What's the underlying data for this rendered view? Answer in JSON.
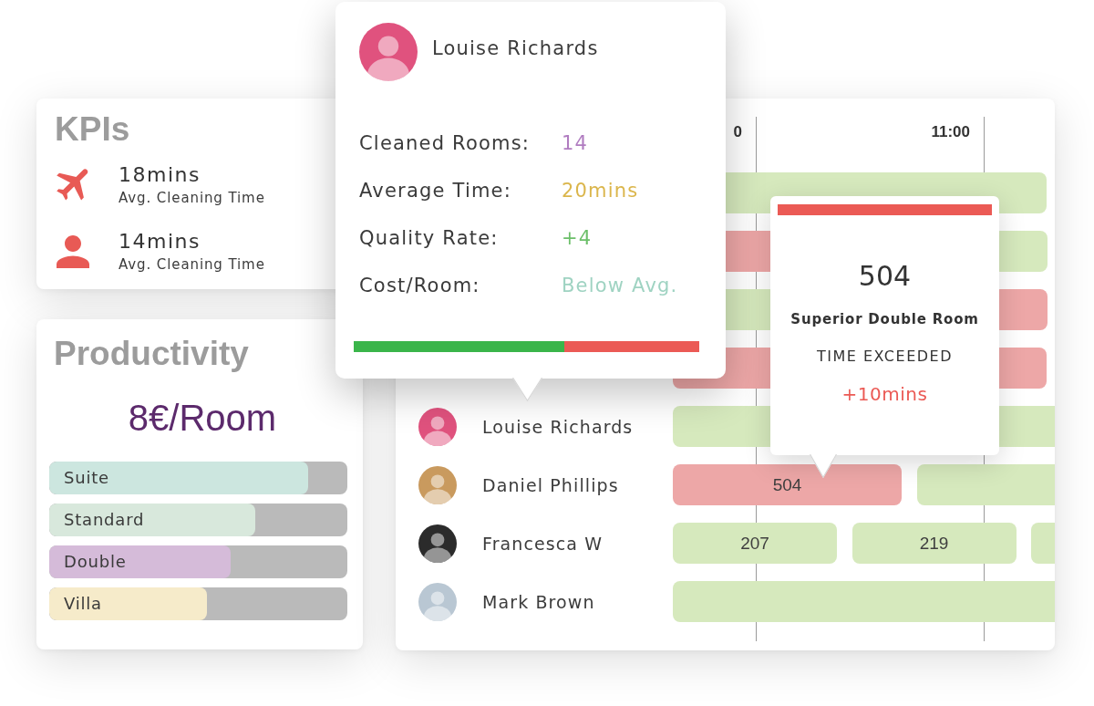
{
  "kpis": {
    "title": "KPIs",
    "items": [
      {
        "value": "18mins",
        "label": "Avg. Cleaning Time"
      },
      {
        "value": "14mins",
        "label": "Avg. Cleaning Time"
      }
    ]
  },
  "productivity": {
    "title": "Productivity",
    "rate": "8€/Room",
    "categories": [
      {
        "name": "Suite",
        "level": 0.87,
        "color": "#cce6df"
      },
      {
        "name": "Standard",
        "level": 0.69,
        "color": "#d8e8dc"
      },
      {
        "name": "Double",
        "level": 0.61,
        "color": "#d5bbd9"
      },
      {
        "name": "Villa",
        "level": 0.53,
        "color": "#f6ebca"
      }
    ]
  },
  "schedule": {
    "time_labels": [
      "0",
      "11:00"
    ],
    "rows": [
      {
        "bars": [
          {
            "exceeded": false
          }
        ]
      },
      {
        "bars": [
          {
            "exceeded": true
          },
          {
            "exceeded": false
          }
        ]
      },
      {
        "bars": [
          {
            "exceeded": false
          },
          {
            "exceeded": true
          }
        ]
      },
      {
        "bars": [
          {
            "exceeded": true
          }
        ]
      },
      {
        "name": "Louise Richards",
        "color": "#e0527e",
        "bars": [
          {
            "exceeded": false
          }
        ]
      },
      {
        "name": "Daniel Phillips",
        "color": "#c99a5e",
        "bars": [
          {
            "exceeded": true,
            "room": "504"
          },
          {
            "exceeded": false
          }
        ]
      },
      {
        "name": "Francesca W",
        "color": "#2b2b2b",
        "bars": [
          {
            "exceeded": false,
            "room": "207"
          },
          {
            "exceeded": false,
            "room": "219"
          },
          {
            "exceeded": false
          }
        ]
      },
      {
        "name": "Mark Brown",
        "color": "#b9c7d3",
        "bars": [
          {
            "exceeded": false
          }
        ]
      }
    ]
  },
  "staff_popover": {
    "name": "Louise Richards",
    "color": "#e0527e",
    "stats": [
      {
        "label": "Cleaned Rooms:",
        "value": "14",
        "color": "#b07cc0"
      },
      {
        "label": "Average Time:",
        "value": "20mins",
        "color": "#dbb64c"
      },
      {
        "label": "Quality Rate:",
        "value": "+4",
        "color": "#6cbf6a"
      },
      {
        "label": "Cost/Room:",
        "value": "Below Avg.",
        "color": "#9fd3c2"
      }
    ],
    "score_bar": {
      "level": 0.61
    }
  },
  "room_tooltip": {
    "room": "504",
    "room_type": "Superior Double Room",
    "status": "TIME EXCEEDED",
    "delay": "+10mins"
  }
}
